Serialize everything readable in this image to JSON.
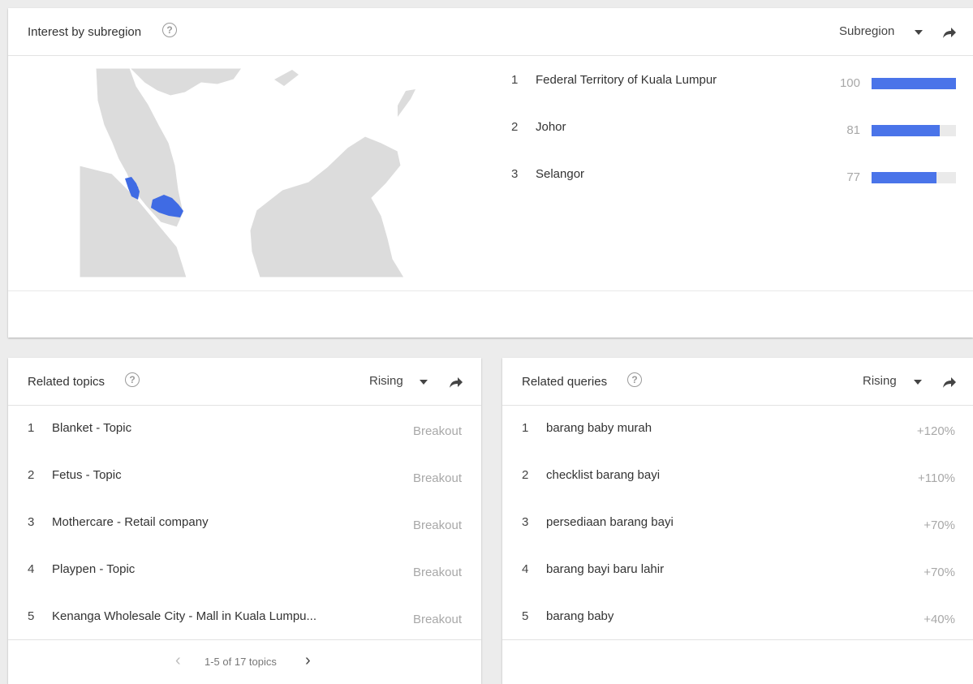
{
  "subregion": {
    "title": "Interest by subregion",
    "selector_label": "Subregion",
    "items": [
      {
        "rank": "1",
        "label": "Federal Territory of Kuala Lumpur",
        "value": 100
      },
      {
        "rank": "2",
        "label": "Johor",
        "value": 81
      },
      {
        "rank": "3",
        "label": "Selangor",
        "value": 77
      }
    ],
    "map_colors": {
      "land": "#dcdcdc",
      "highlight": "#3f6be4"
    }
  },
  "topics": {
    "title": "Related topics",
    "selector_label": "Rising",
    "items": [
      {
        "rank": "1",
        "label": "Blanket - Topic",
        "value": "Breakout"
      },
      {
        "rank": "2",
        "label": "Fetus - Topic",
        "value": "Breakout"
      },
      {
        "rank": "3",
        "label": "Mothercare - Retail company",
        "value": "Breakout"
      },
      {
        "rank": "4",
        "label": "Playpen - Topic",
        "value": "Breakout"
      },
      {
        "rank": "5",
        "label": "Kenanga Wholesale City - Mall in Kuala Lumpu...",
        "value": "Breakout"
      }
    ],
    "pagination": {
      "text": "1-5 of 17 topics",
      "prev": "‹",
      "next": "›"
    }
  },
  "queries": {
    "title": "Related queries",
    "selector_label": "Rising",
    "items": [
      {
        "rank": "1",
        "label": "barang baby murah",
        "value": "+120%"
      },
      {
        "rank": "2",
        "label": "checklist barang bayi",
        "value": "+110%"
      },
      {
        "rank": "3",
        "label": "persediaan barang bayi",
        "value": "+70%"
      },
      {
        "rank": "4",
        "label": "barang bayi baru lahir",
        "value": "+70%"
      },
      {
        "rank": "5",
        "label": "barang baby",
        "value": "+40%"
      }
    ]
  },
  "icons": {
    "help": "help-circle-icon",
    "dropdown": "caret-down-icon",
    "share": "share-arrow-icon"
  }
}
